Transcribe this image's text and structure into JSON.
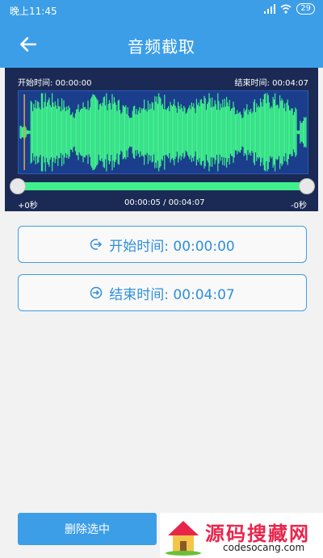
{
  "status_bar": {
    "time": "晚上11:45",
    "battery": "29"
  },
  "app_bar": {
    "title": "音频截取"
  },
  "waveform": {
    "start_label": "开始时间: 00:00:00",
    "end_label": "结束时间: 00:04:07",
    "left_offset": "+0秒",
    "position": "00:00:05 / 00:04:07",
    "right_offset": "-0秒",
    "wave_color": "#3ff08c",
    "playhead_fraction": 0.02
  },
  "buttons": {
    "start_time": "开始时间: 00:00:00",
    "end_time": "结束时间: 00:04:07",
    "delete_selected": "删除选中"
  },
  "watermark": {
    "title": "源码搜藏网",
    "url": "codesocang.com"
  },
  "colors": {
    "accent": "#3d9ee8",
    "wave": "#3ff08c",
    "panel": "#1b2a54"
  }
}
